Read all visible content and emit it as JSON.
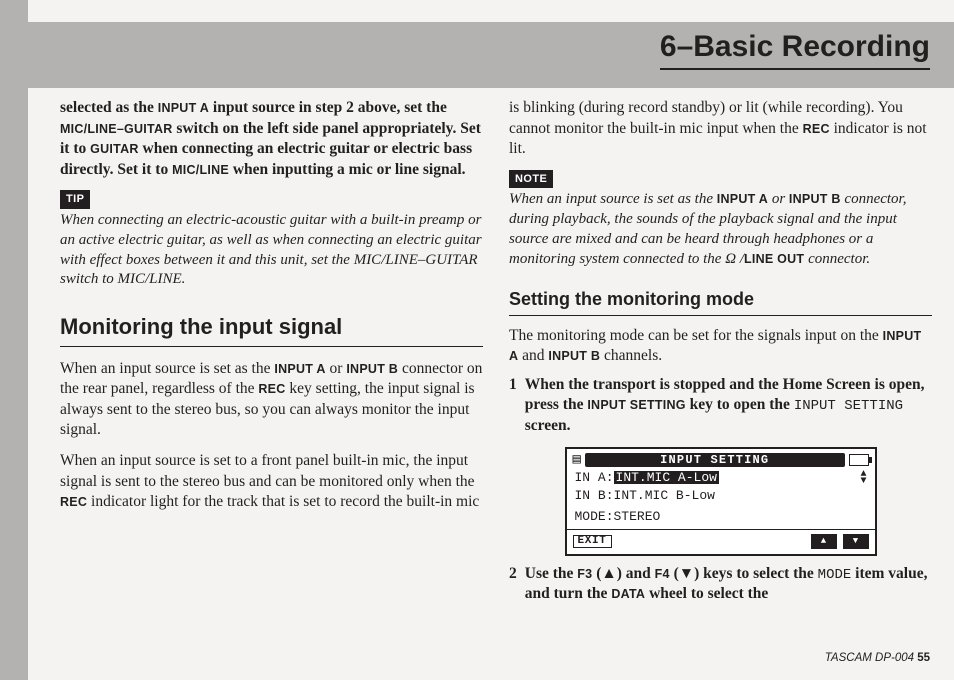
{
  "header": {
    "title": "6–Basic Recording"
  },
  "left_column": {
    "intro_bold": {
      "pre1": "selected as the ",
      "input_a": "INPUT A",
      "mid1": " input source in step 2 above, set the ",
      "switch": "MIC/LINE–GUITAR",
      "mid2": " switch on the left side panel appropriately. Set it to ",
      "guitar": "GUITAR",
      "mid3": " when connecting an electric guitar or electric bass directly. Set it to ",
      "micline": "MIC/LINE",
      "post": " when inputting a mic or line signal."
    },
    "tip_label": "TIP",
    "tip_text": "When connecting an electric-acoustic guitar with a built-in preamp or an active electric guitar, as well as when connecting an electric guitar with effect boxes between it and this unit, set the MIC/LINE–GUITAR switch to MIC/LINE.",
    "section_title": "Monitoring the input signal",
    "para1": {
      "pre": "When an input source is set as the ",
      "ia": "INPUT A",
      "or": " or ",
      "ib": "INPUT B",
      "mid": " connector on the rear panel, regardless of the ",
      "rec": "REC",
      "post": " key setting, the input signal is always sent to the stereo bus, so you can always monitor the input signal."
    },
    "para2": {
      "pre": "When an input source is set to a front panel built-in mic, the input signal is sent to the stereo bus and can be monitored only when the ",
      "rec": "REC",
      "post": " indicator light for the track that is set to record the built-in mic"
    }
  },
  "right_column": {
    "cont": {
      "pre": "is blinking (during record standby) or lit (while recording). You cannot monitor the built-in mic input when the ",
      "rec": "REC",
      "post": " indicator is not lit."
    },
    "note_label": "NOTE",
    "note_text": {
      "pre": "When an input source is set as the ",
      "ia": "INPUT A",
      "or": " or ",
      "ib": "INPUT B",
      "mid": " connector, during playback, the sounds of the playback signal and the input source are mixed and can be heard through headphones or a monitoring system connected to the ",
      "omega": " Ω /",
      "lo": "LINE OUT",
      "post": " connector."
    },
    "sub_title": "Setting the monitoring mode",
    "para_a": {
      "pre": "The monitoring mode can be set for the signals input on the ",
      "ia": "INPUT A",
      "and": " and ",
      "ib": "INPUT B",
      "post": " channels."
    },
    "step1": {
      "num": "1",
      "pre": "When the transport is stopped and the Home Screen is open, press the ",
      "key": "INPUT SETTING",
      "mid": " key to open the ",
      "mono": "INPUT SETTING",
      "post": " screen."
    },
    "lcd": {
      "title": "INPUT SETTING",
      "line_a_label": "IN A:",
      "line_a_val": "INT.MIC A-Low",
      "line_b_label": "IN B:",
      "line_b_val": "INT.MIC B-Low",
      "mode_line": "MODE:STEREO",
      "exit": "EXIT"
    },
    "step2": {
      "num": "2",
      "pre": "Use the ",
      "f3": "F3",
      "up": " (▲) and ",
      "f4": "F4",
      "down": " (▼) keys to select the ",
      "mode": "MODE",
      "mid": " item value, and turn the ",
      "data": "DATA",
      "post": " wheel to select the"
    }
  },
  "footer": {
    "prefix": "TASCAM  DP-004 ",
    "page": "55"
  }
}
